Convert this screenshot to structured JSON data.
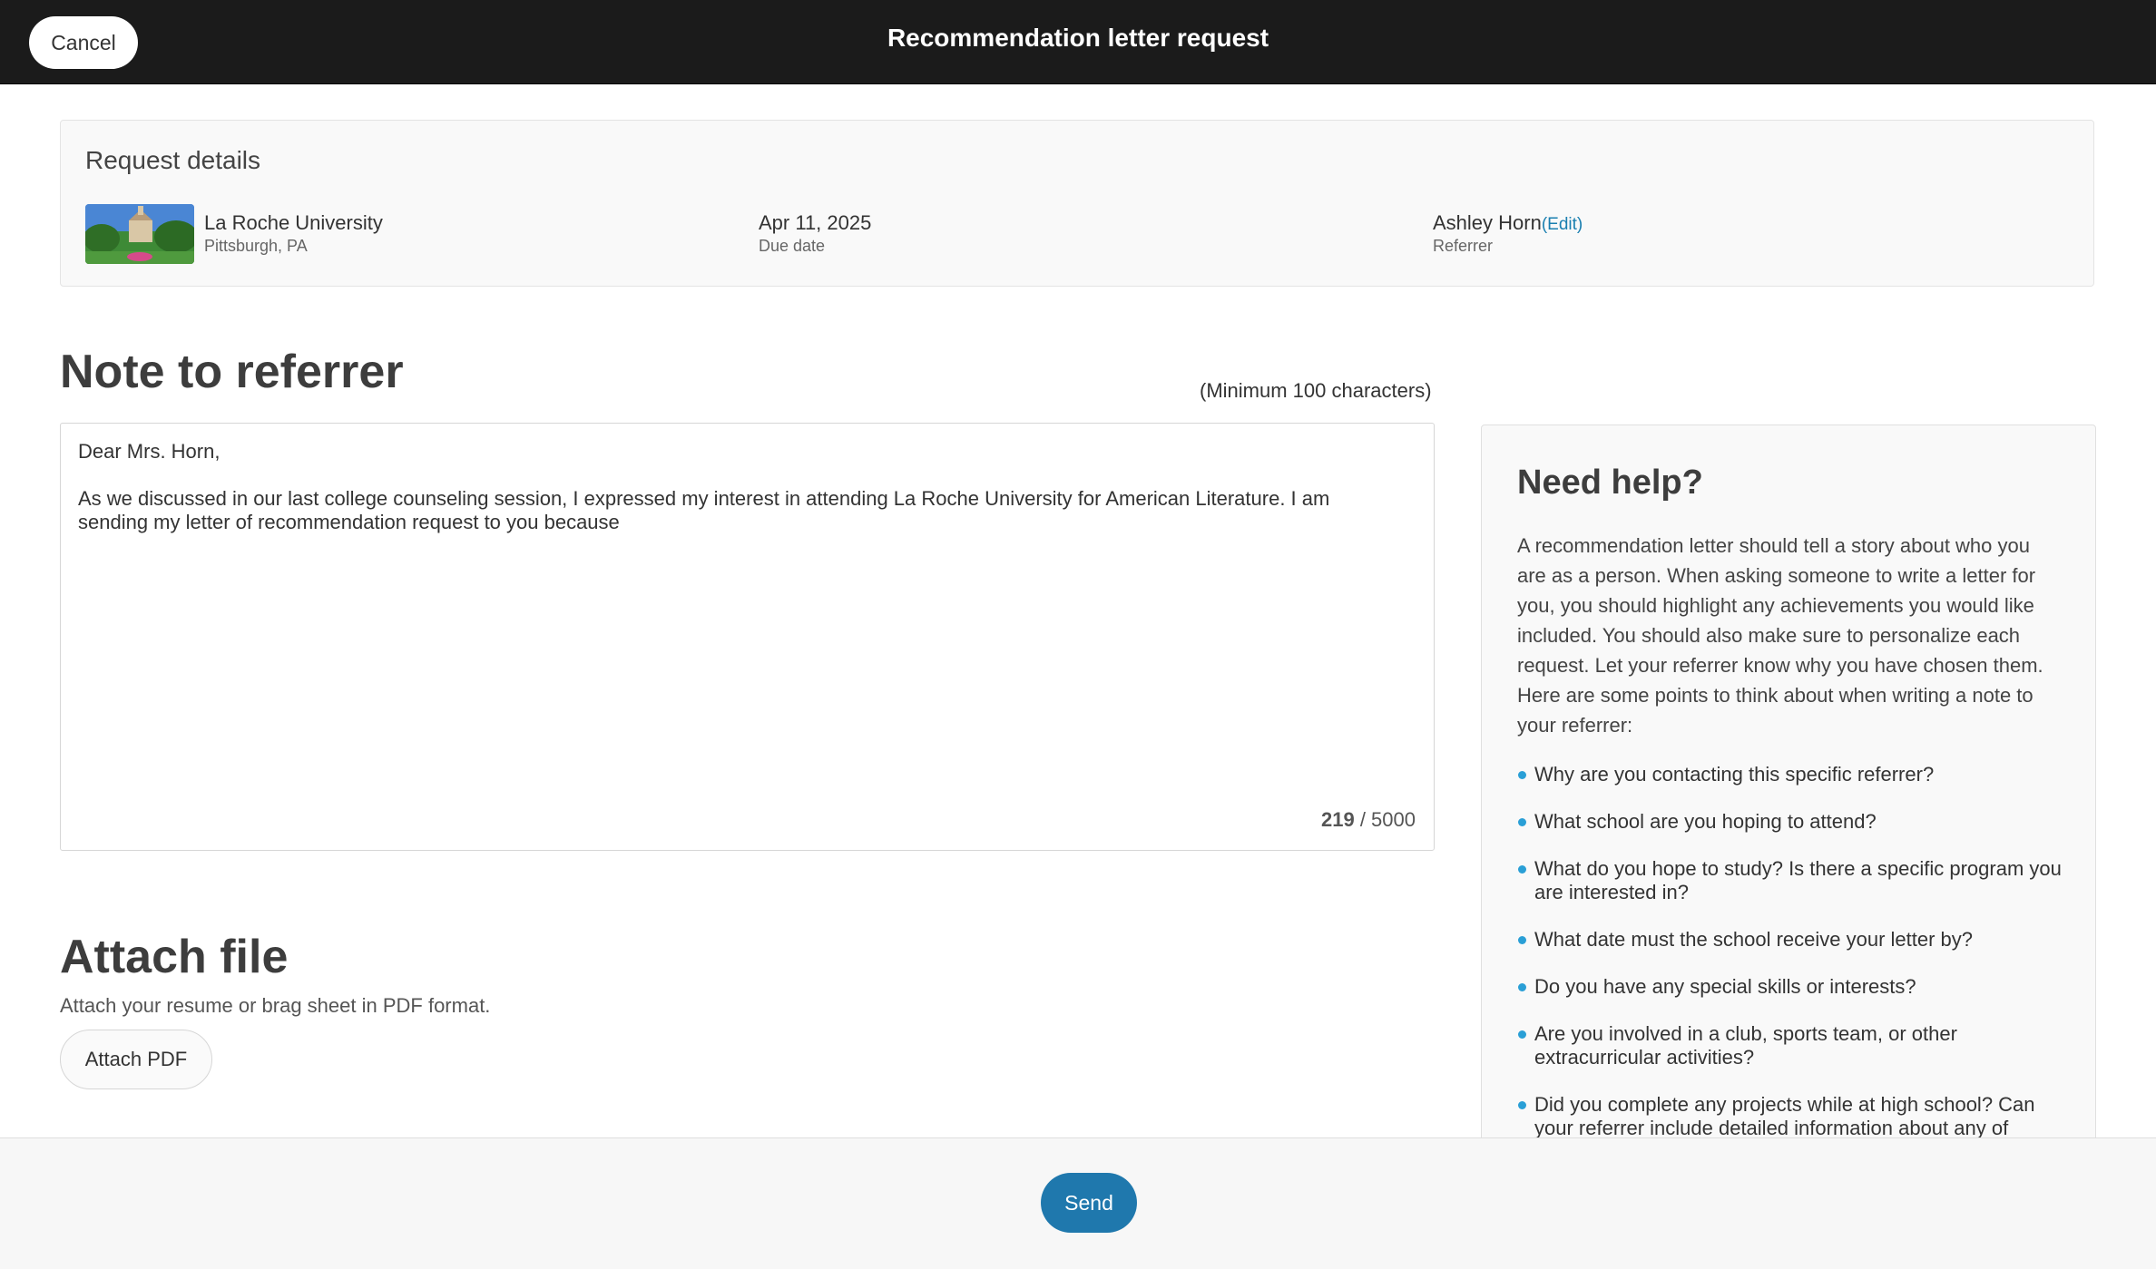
{
  "header": {
    "cancel_label": "Cancel",
    "title": "Recommendation letter request"
  },
  "request_details": {
    "heading": "Request details",
    "school_name": "La Roche University",
    "school_location": "Pittsburgh, PA",
    "due_date": "Apr 11, 2025",
    "due_date_label": "Due date",
    "referrer_name": "Ashley Horn",
    "edit_label": "(Edit)",
    "referrer_label": "Referrer"
  },
  "note": {
    "heading": "Note to referrer",
    "min_label": "(Minimum 100 characters)",
    "value": "Dear Mrs. Horn,\n\nAs we discussed in our last college counseling session, I expressed my interest in attending La Roche University for American Literature. I am sending my letter of recommendation request to you because",
    "char_count": "219",
    "char_max": " / 5000"
  },
  "attach": {
    "heading": "Attach file",
    "description": "Attach your resume or brag sheet in PDF format.",
    "button_label": "Attach PDF"
  },
  "help": {
    "heading": "Need help?",
    "body": "A recommendation letter should tell a story about who you are as a person. When asking someone to write a letter for you, you should highlight any achievements you would like included. You should also make sure to personalize each request. Let your referrer know why you have chosen them. Here are some points to think about when writing a note to your referrer:",
    "items": [
      "Why are you contacting this specific referrer?",
      "What school are you hoping to attend?",
      "What do you hope to study? Is there a specific program you are interested in?",
      "What date must the school receive your letter by?",
      "Do you have any special skills or interests?",
      "Are you involved in a club, sports team, or other extracurricular activities?",
      "Did you complete any projects while at high school? Can your referrer include detailed information about any of"
    ]
  },
  "footer": {
    "send_label": "Send"
  },
  "colors": {
    "header_bg": "#1b1b1b",
    "accent": "#1f78ad",
    "link": "#1a7fb0",
    "bullet": "#2a9fd6"
  }
}
